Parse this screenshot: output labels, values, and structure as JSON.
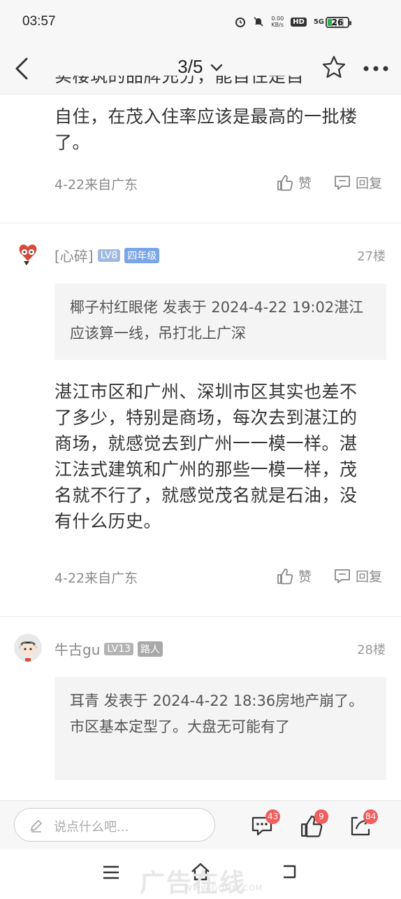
{
  "status": {
    "time": "03:57",
    "net_speed_value": "0.00",
    "net_speed_unit": "KB/s",
    "hd_label": "HD",
    "network": "5G",
    "battery": "26"
  },
  "nav": {
    "pager": "3/5",
    "icons": [
      "back-arrow-icon",
      "chevron-down-icon",
      "star-icon",
      "more-icon"
    ]
  },
  "post_top": {
    "partial_line": "实楼筑的品牌充分，能自住是自",
    "body": "自住，在茂入住率应该是最高的一批楼了。",
    "meta": "4-22来自广东",
    "like_label": "赞",
    "reply_label": "回复"
  },
  "post_27": {
    "username": "[心碎]",
    "level": "LV8",
    "rank": "四年级",
    "floor": "27楼",
    "quote": "椰子村红眼佬 发表于 2024-4-22 19:02湛江应该算一线，吊打北上广深",
    "body": "湛江市区和广州、深圳市区其实也差不了多少，特别是商场，每次去到湛江的商场，就感觉去到广州一一模一样。湛江法式建筑和广州的那些一模一样，茂名就不行了，就感觉茂名就是石油，没有什么历史。",
    "meta": "4-22来自广东",
    "like_label": "赞",
    "reply_label": "回复"
  },
  "post_28": {
    "username": "牛古gu",
    "level": "LV13",
    "rank": "路人",
    "floor": "28楼",
    "quote": "耳青 发表于 2024-4-22 18:36房地产崩了。市区基本定型了。大盘无可能有了"
  },
  "bottom": {
    "input_placeholder": "说点什么吧...",
    "comments_count": "43",
    "likes_count": "9",
    "shares_count": "84"
  },
  "watermark": {
    "text": "广告在线",
    "sub": "WWW.GDMM.COM"
  },
  "colors": {
    "accent_red": "#f25d5d",
    "level_blue": "#9fb9e0",
    "rank_blue": "#7aa5e6"
  }
}
